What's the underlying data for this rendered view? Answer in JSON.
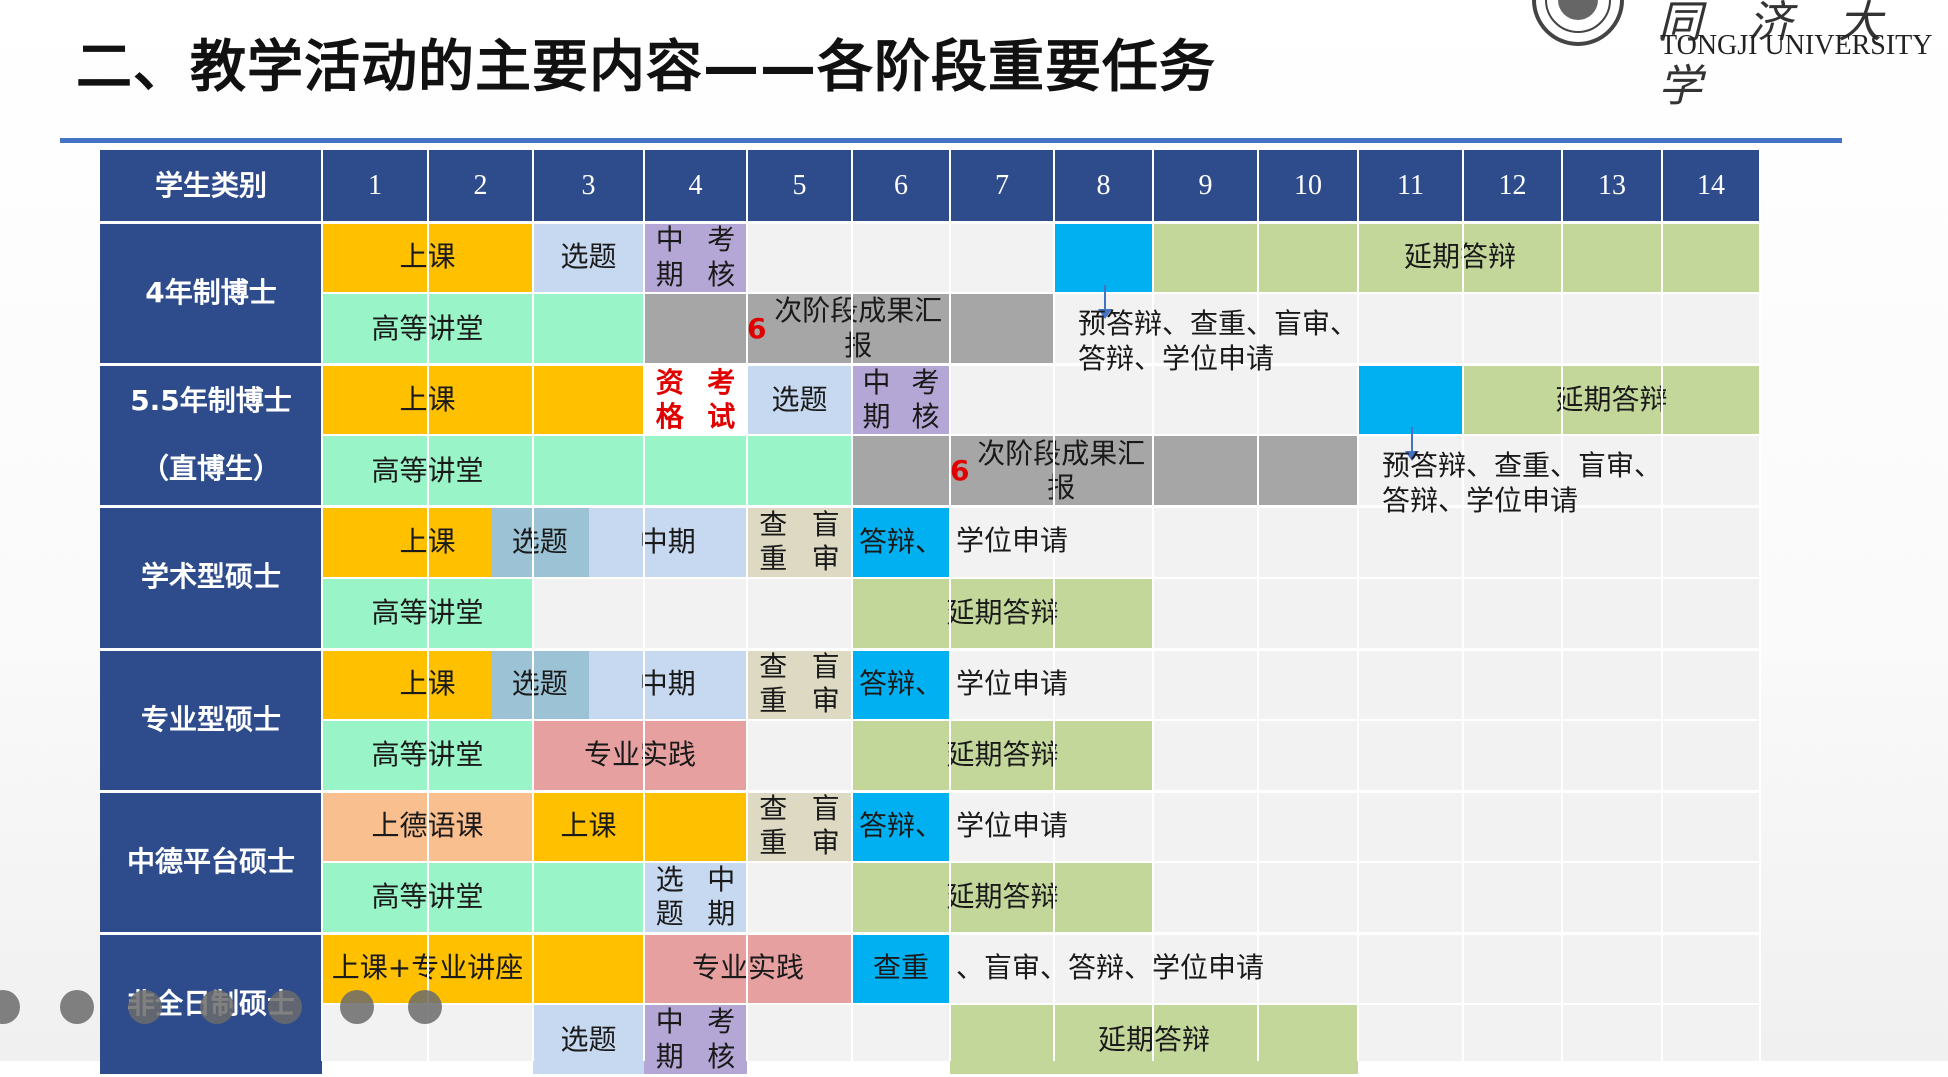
{
  "title": "二、教学活动的主要内容——各阶段重要任务",
  "logo": {
    "cn": "同 济 大 学",
    "en": "TONGJI UNIVERSITY",
    "seal_icon": "tongji-seal-icon"
  },
  "colors": {
    "header": "#2e4c8c",
    "course": "#ffc000",
    "topic": "#c6d9f0",
    "midterm": "#b4a7d6",
    "blue": "#00b0f0",
    "green": "#c4d79b",
    "mint": "#99f5c8",
    "gray": "#a6a6a6",
    "tan": "#ddd9c3",
    "salmon": "#fabf8f",
    "rose": "#e6a0a0",
    "steel": "#9cc3d5",
    "grid": "#f2f2f2"
  },
  "table": {
    "header_label": "学生类别",
    "months": [
      "1",
      "2",
      "3",
      "4",
      "5",
      "6",
      "7",
      "8",
      "9",
      "10",
      "11",
      "12",
      "13",
      "14"
    ],
    "categories": [
      {
        "lines": [
          "4年制博士"
        ]
      },
      {
        "lines": [
          "5.5年制博士",
          "（直博生）"
        ]
      },
      {
        "lines": [
          "学术型硕士"
        ]
      },
      {
        "lines": [
          "专业型硕士"
        ]
      },
      {
        "lines": [
          "中德平台硕士"
        ]
      },
      {
        "lines": [
          "非全日制硕士"
        ]
      }
    ],
    "blocks": [
      {
        "row": 0,
        "from": 1,
        "to": 2,
        "color": "course",
        "label": "上课"
      },
      {
        "row": 0,
        "from": 3,
        "to": 3,
        "color": "topic",
        "label": "选题"
      },
      {
        "row": 0,
        "from": 4,
        "to": 4,
        "color": "midterm",
        "label": "中期\n考核"
      },
      {
        "row": 0,
        "from": 8,
        "to": 8,
        "color": "blue",
        "label": ""
      },
      {
        "row": 0,
        "from": 9,
        "to": 14,
        "color": "green",
        "label": "延期答辩",
        "label_at": [
          11,
          12
        ]
      },
      {
        "row": 1,
        "from": 1,
        "to": 3,
        "color": "mint",
        "label": "高等讲堂",
        "label_at": [
          1,
          2
        ]
      },
      {
        "row": 1,
        "from": 4,
        "to": 7,
        "color": "gray",
        "label": "6次阶段成果汇报",
        "red_prefix": "6",
        "label_at": [
          5,
          6
        ]
      },
      {
        "row": 2,
        "from": 1,
        "to": 3,
        "color": "course",
        "label": "上课",
        "label_at": [
          1,
          2
        ]
      },
      {
        "row": 2,
        "from": 4,
        "to": 4,
        "color": "white",
        "label": "资格\n考试",
        "red": true
      },
      {
        "row": 2,
        "from": 5,
        "to": 5,
        "color": "topic",
        "label": "选题"
      },
      {
        "row": 2,
        "from": 6,
        "to": 6,
        "color": "midterm",
        "label": "中期\n考核"
      },
      {
        "row": 2,
        "from": 11,
        "to": 11,
        "color": "blue",
        "label": ""
      },
      {
        "row": 2,
        "from": 12,
        "to": 14,
        "color": "green",
        "label": "延期答辩"
      },
      {
        "row": 3,
        "from": 1,
        "to": 5,
        "color": "mint",
        "label": "高等讲堂",
        "label_at": [
          1,
          2
        ]
      },
      {
        "row": 3,
        "from": 6,
        "to": 10,
        "color": "gray",
        "label": "6次阶段成果汇报",
        "red_prefix": "6",
        "label_at": [
          7,
          8
        ]
      },
      {
        "row": 4,
        "from": 1,
        "to": 2,
        "color": "course",
        "label": "上课",
        "label_at": [
          1,
          2
        ]
      },
      {
        "row": 4,
        "from": 2.6,
        "to": 3.5,
        "color": "steel",
        "label": "选题"
      },
      {
        "row": 4,
        "from": 3.5,
        "to": 4,
        "color": "topic",
        "label": "中\n期"
      },
      {
        "row": 4,
        "from": 5,
        "to": 5,
        "color": "tan",
        "label": "查重\n盲审"
      },
      {
        "row": 4,
        "from": 6,
        "to": 6,
        "color": "blue",
        "label": "答辩、"
      },
      {
        "row": 5,
        "from": 1,
        "to": 2,
        "color": "mint",
        "label": "高等讲堂"
      },
      {
        "row": 5,
        "from": 6,
        "to": 8,
        "color": "green",
        "label": "延期答辩"
      },
      {
        "row": 6,
        "from": 1,
        "to": 2,
        "color": "course",
        "label": "上课",
        "label_at": [
          1,
          2
        ]
      },
      {
        "row": 6,
        "from": 2.6,
        "to": 3.5,
        "color": "steel",
        "label": "选题"
      },
      {
        "row": 6,
        "from": 3.5,
        "to": 4,
        "color": "topic",
        "label": "中\n期"
      },
      {
        "row": 6,
        "from": 5,
        "to": 5,
        "color": "tan",
        "label": "查重\n盲审"
      },
      {
        "row": 6,
        "from": 6,
        "to": 6,
        "color": "blue",
        "label": "答辩、"
      },
      {
        "row": 7,
        "from": 1,
        "to": 2,
        "color": "mint",
        "label": "高等讲堂"
      },
      {
        "row": 7,
        "from": 3,
        "to": 4,
        "color": "rose",
        "label": "专业实践"
      },
      {
        "row": 7,
        "from": 6,
        "to": 8,
        "color": "green",
        "label": "延期答辩"
      },
      {
        "row": 8,
        "from": 1,
        "to": 2,
        "color": "salmon",
        "label": "上德语课"
      },
      {
        "row": 8,
        "from": 3,
        "to": 4,
        "color": "course",
        "label": "上课",
        "label_at": [
          3,
          3
        ]
      },
      {
        "row": 8,
        "from": 5,
        "to": 5,
        "color": "tan",
        "label": "查重\n盲审"
      },
      {
        "row": 8,
        "from": 6,
        "to": 6,
        "color": "blue",
        "label": "答辩、"
      },
      {
        "row": 9,
        "from": 1,
        "to": 3,
        "color": "mint",
        "label": "高等讲堂",
        "label_at": [
          1,
          2
        ]
      },
      {
        "row": 9,
        "from": 4,
        "to": 4,
        "color": "topic",
        "label": "选题\n中期"
      },
      {
        "row": 9,
        "from": 6,
        "to": 8,
        "color": "green",
        "label": "延期答辩"
      },
      {
        "row": 10,
        "from": 1,
        "to": 3,
        "color": "course",
        "label": "上课+专业讲座",
        "label_at": [
          1,
          2
        ]
      },
      {
        "row": 10,
        "from": 4,
        "to": 5,
        "color": "rose",
        "label": "专业实践"
      },
      {
        "row": 10,
        "from": 6,
        "to": 6,
        "color": "blue",
        "label": "查重"
      },
      {
        "row": 11,
        "from": 3,
        "to": 3,
        "color": "topic",
        "label": "选题"
      },
      {
        "row": 11,
        "from": 4,
        "to": 4,
        "color": "midterm",
        "label": "中期\n考核"
      },
      {
        "row": 11,
        "from": 7,
        "to": 10,
        "color": "green",
        "label": "延期答辩"
      }
    ],
    "notes": [
      {
        "text": "学位申请",
        "row": 4,
        "col": 7
      },
      {
        "text": "学位申请",
        "row": 6,
        "col": 7
      },
      {
        "text": "学位申请",
        "row": 8,
        "col": 7
      },
      {
        "text": "、盲审、答辩、学位申请",
        "row": 10,
        "col": 7
      }
    ],
    "callouts": [
      {
        "text": "预答辩、查重、盲审、\n答辩、学位申请",
        "col": 8,
        "row": 1
      },
      {
        "text": "预答辩、查重、盲审、\n答辩、学位申请",
        "col": 11,
        "row": 3
      }
    ]
  },
  "toolbar": [
    "prev-icon",
    "play-icon",
    "pen-icon",
    "zoom-icon",
    "camera-icon",
    "comment-icon",
    "more-icon"
  ]
}
